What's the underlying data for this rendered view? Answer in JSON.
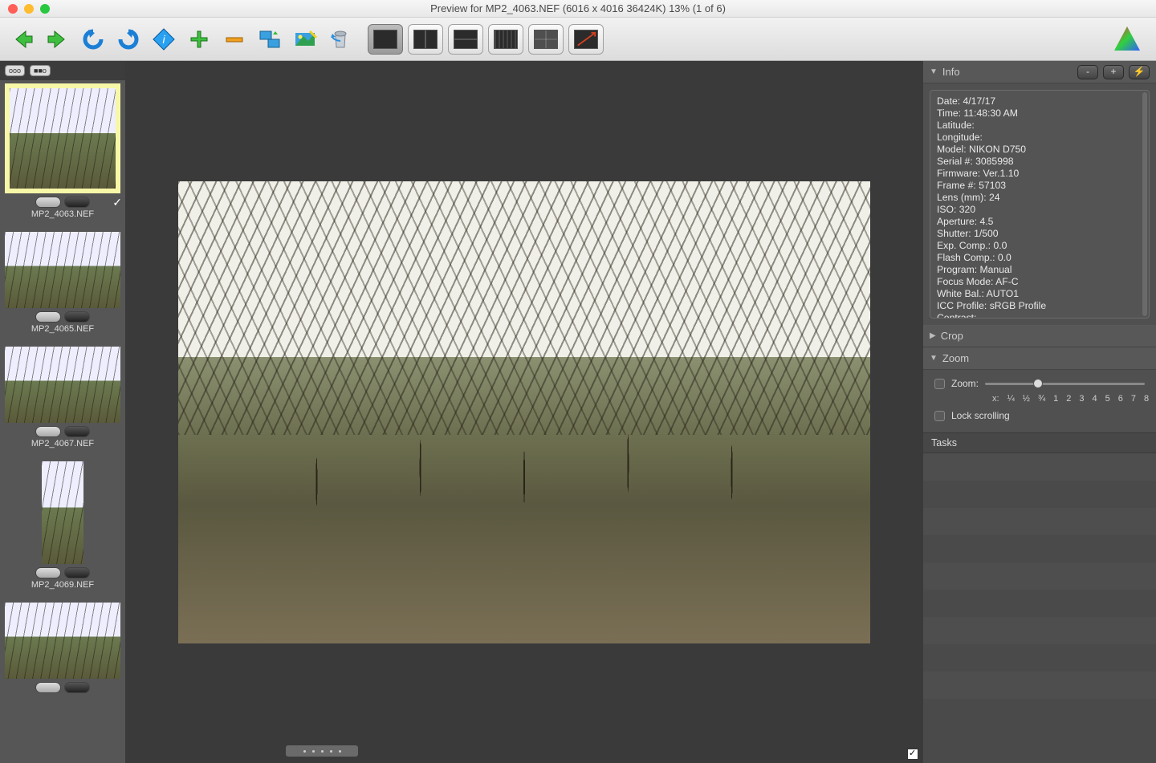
{
  "window": {
    "title": "Preview for MP2_4063.NEF (6016 x 4016 36424K) 13% (1 of 6)"
  },
  "toolbar": {
    "buttons": [
      "back",
      "forward",
      "undo",
      "redo",
      "info",
      "add",
      "remove",
      "batch",
      "adjust",
      "delete"
    ]
  },
  "strip_header": {
    "btn1": "ooo",
    "btn2": "■■o"
  },
  "thumbs": [
    {
      "name": "MP2_4063.NEF",
      "selected": true,
      "checked": true,
      "orientation": "landscape"
    },
    {
      "name": "MP2_4065.NEF",
      "selected": false,
      "checked": false,
      "orientation": "landscape"
    },
    {
      "name": "MP2_4067.NEF",
      "selected": false,
      "checked": false,
      "orientation": "landscape"
    },
    {
      "name": "MP2_4069.NEF",
      "selected": false,
      "checked": false,
      "orientation": "portrait"
    },
    {
      "name": "",
      "selected": false,
      "checked": false,
      "orientation": "landscape"
    }
  ],
  "panels": {
    "info_title": "Info",
    "info_minus": "-",
    "info_plus": "+",
    "info_flash": "⚡",
    "crop_title": "Crop",
    "zoom_title": "Zoom",
    "zoom_label": "Zoom:",
    "zoom_xlabel": "x:",
    "zoom_ticks": [
      "¼",
      "½",
      "¾",
      "1",
      "2",
      "3",
      "4",
      "5",
      "6",
      "7",
      "8"
    ],
    "lock_scroll": "Lock scrolling",
    "tasks_title": "Tasks"
  },
  "info": {
    "Date": "4/17/17",
    "Time": "11:48:30 AM",
    "Latitude": "",
    "Longitude": "",
    "Model": "NIKON D750",
    "Serial #": "3085998",
    "Firmware": "Ver.1.10",
    "Frame #": "57103",
    "Lens (mm)": "24",
    "ISO": "320",
    "Aperture": "4.5",
    "Shutter": "1/500",
    "Exp. Comp.": "0.0",
    "Flash Comp.": "0.0",
    "Program": "Manual",
    "Focus Mode": "AF-C",
    "White Bal.": "AUTO1",
    "ICC Profile": "sRGB Profile",
    "Contrast": ""
  }
}
